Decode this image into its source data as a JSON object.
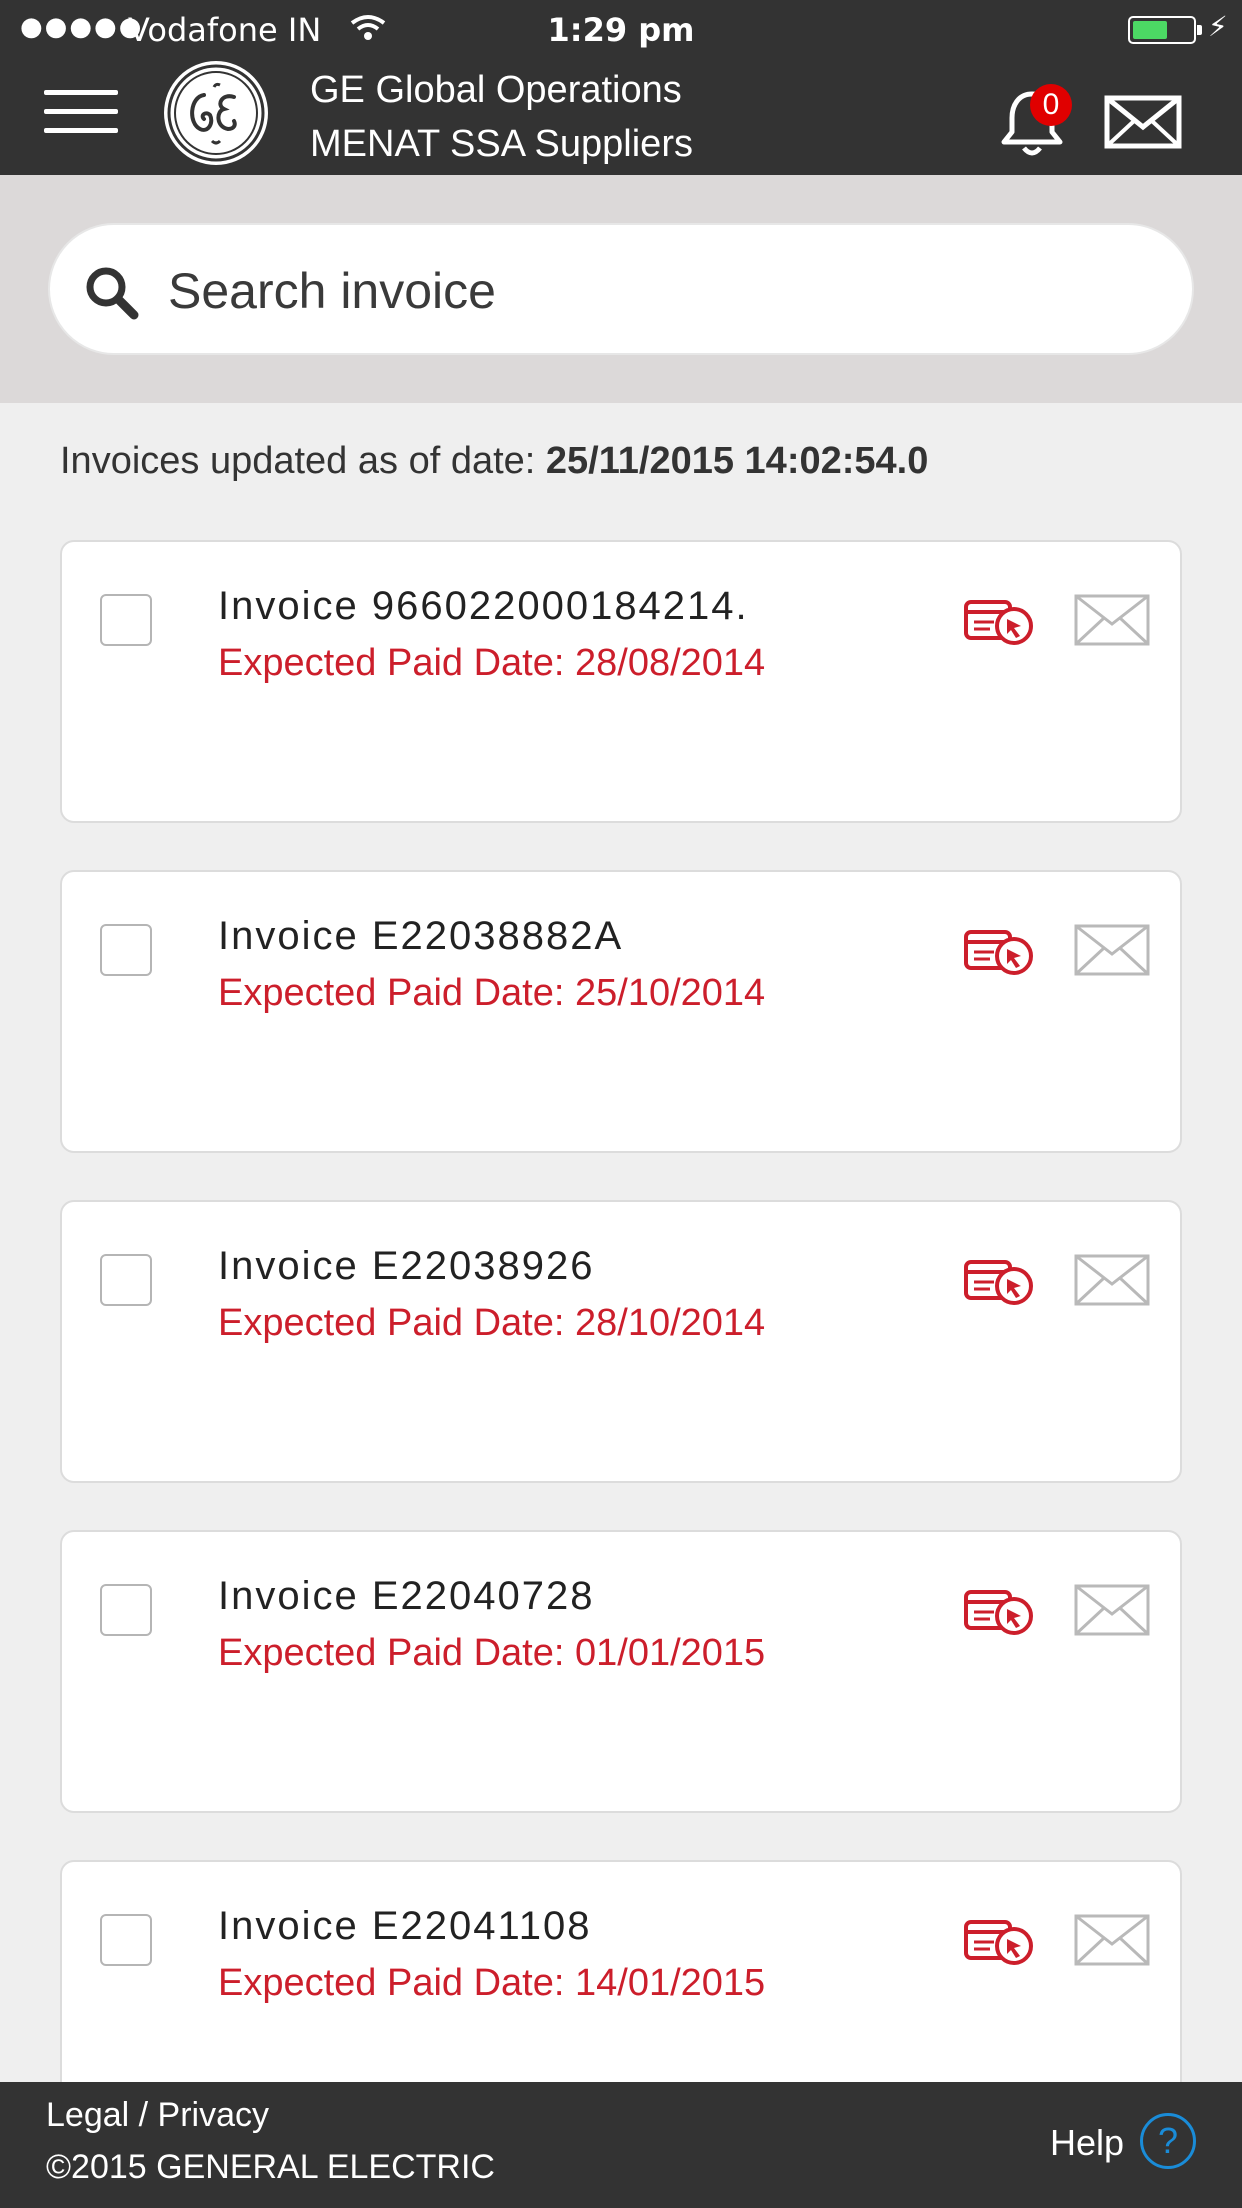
{
  "status_bar": {
    "signal_dots": "●●●●●",
    "carrier": "Vodafone IN",
    "time": "1:29 pm",
    "battery_level": 0.55,
    "battery_color": "#4cd964"
  },
  "header": {
    "title_line1": "GE Global Operations",
    "title_line2": "MENAT SSA Suppliers",
    "notification_count": "0",
    "icons": [
      "menu-icon",
      "ge-logo",
      "bell-icon",
      "mail-icon"
    ]
  },
  "search": {
    "placeholder": "Search invoice",
    "value": ""
  },
  "updated": {
    "label": "Invoices updated as of date: ",
    "datetime": "25/11/2015 14:02:54.0"
  },
  "invoices": [
    {
      "title": "Invoice 966022000184214.",
      "expected": "Expected Paid Date: 28/08/2014",
      "checked": false
    },
    {
      "title": "Invoice E22038882A",
      "expected": "Expected Paid Date: 25/10/2014",
      "checked": false
    },
    {
      "title": "Invoice E22038926",
      "expected": "Expected Paid Date: 28/10/2014",
      "checked": false
    },
    {
      "title": "Invoice E22040728",
      "expected": "Expected Paid Date: 01/01/2015",
      "checked": false
    },
    {
      "title": "Invoice E22041108",
      "expected": "Expected Paid Date: 14/01/2015",
      "checked": false
    }
  ],
  "footer": {
    "legal": "Legal / Privacy",
    "copyright": "©2015 GENERAL ELECTRIC",
    "help_label": "Help",
    "help_symbol": "?"
  },
  "colors": {
    "bar_bg": "#333333",
    "accent_red": "#cc1e2b",
    "badge_red": "#e00000",
    "help_blue": "#1a8cd8"
  }
}
